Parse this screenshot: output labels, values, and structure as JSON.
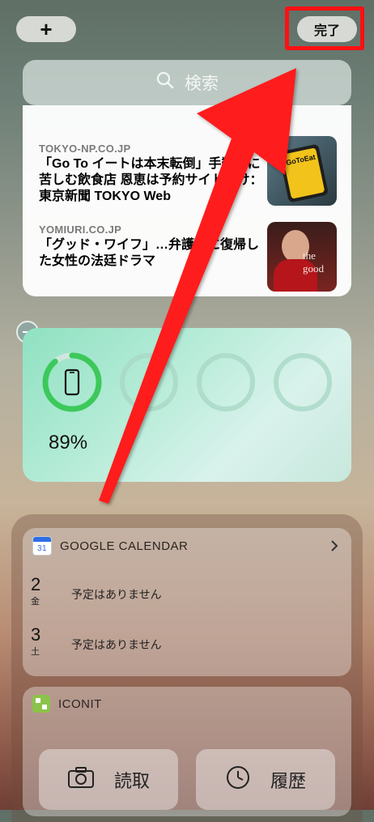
{
  "top": {
    "plus_label": "+",
    "done_label": "完了"
  },
  "search": {
    "placeholder": "検索",
    "icon": "search-icon"
  },
  "news": [
    {
      "source": "TOKYO-NP.CO.JP",
      "title": "「Go To イートは本末転倒」手数料に苦しむ飲食店 恩恵は予約サイトだけ：東京新聞 TOKYO Web",
      "thumb_text": "GoToEat"
    },
    {
      "source": "YOMIURI.CO.JP",
      "title": "「グッド・ワイフ」…弁護士に復帰した女性の法廷ドラマ",
      "thumb_text": "the good"
    }
  ],
  "battery": {
    "percent": "89%",
    "level": 0.89,
    "accent": "#3cc95a"
  },
  "calendar": {
    "header": "GOOGLE CALENDAR",
    "icon_text": "31",
    "days": [
      {
        "date": "2",
        "dow": "金",
        "text": "予定はありません"
      },
      {
        "date": "3",
        "dow": "土",
        "text": "予定はありません"
      }
    ]
  },
  "iconit": {
    "header": "ICONIT",
    "buttons": [
      {
        "label": "読取",
        "icon": "camera-icon"
      },
      {
        "label": "履歴",
        "icon": "clock-icon"
      }
    ]
  },
  "colors": {
    "highlight": "#ff1010",
    "arrow": "#ff1a1a"
  }
}
